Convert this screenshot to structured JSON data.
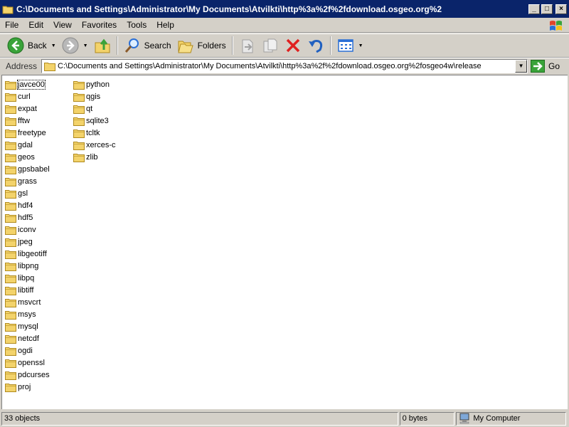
{
  "window": {
    "title": "C:\\Documents and Settings\\Administrator\\My Documents\\Atvilkti\\http%3a%2f%2fdownload.osgeo.org%2",
    "buttons": [
      "0",
      "1",
      "r"
    ]
  },
  "menu": [
    "File",
    "Edit",
    "View",
    "Favorites",
    "Tools",
    "Help"
  ],
  "toolbar": {
    "back_label": "Back",
    "search_label": "Search",
    "folders_label": "Folders"
  },
  "address": {
    "label": "Address",
    "value": "C:\\Documents and Settings\\Administrator\\My Documents\\Atvilkti\\http%3a%2f%2fdownload.osgeo.org%2fosgeo4w\\release",
    "go_label": "Go"
  },
  "folders_col1": [
    "javce00",
    "curl",
    "expat",
    "fftw",
    "freetype",
    "gdal",
    "geos",
    "gpsbabel",
    "grass",
    "gsl",
    "hdf4",
    "hdf5",
    "iconv",
    "jpeg",
    "libgeotiff",
    "libpng",
    "libpq",
    "libtiff",
    "msvcrt",
    "msys",
    "mysql",
    "netcdf",
    "ogdi",
    "openssl",
    "pdcurses",
    "proj"
  ],
  "folders_col2": [
    "python",
    "qgis",
    "qt",
    "sqlite3",
    "tcltk",
    "xerces-c",
    "zlib"
  ],
  "status": {
    "objects": "33 objects",
    "size": "0 bytes",
    "zone": "My Computer"
  },
  "colors": {
    "titlebar": "#0a246a",
    "folder": "#f3d36b",
    "folder_edge": "#b08a1e",
    "back_green": "#3aa33a",
    "delete_red": "#e02020",
    "undo_blue": "#2060c0"
  }
}
